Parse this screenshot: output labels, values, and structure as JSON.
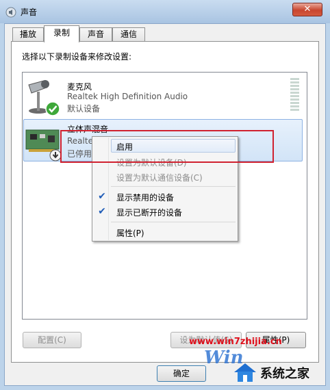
{
  "window": {
    "title": "声音",
    "close_label": "✕"
  },
  "tabs": [
    {
      "label": "播放"
    },
    {
      "label": "录制",
      "active": true
    },
    {
      "label": "声音"
    },
    {
      "label": "通信"
    }
  ],
  "instruction": "选择以下录制设备来修改设置:",
  "devices": [
    {
      "name": "麦克风",
      "driver": "Realtek High Definition Audio",
      "status": "默认设备",
      "icon": "microphone-icon",
      "badge": "default-check-badge"
    },
    {
      "name": "立体声混音",
      "driver": "Realte",
      "status": "已停用",
      "icon": "sound-card-icon",
      "badge": "disabled-arrow-badge"
    }
  ],
  "context_menu": {
    "items": [
      {
        "label": "启用",
        "enabled": true,
        "highlighted": true
      },
      {
        "label": "设置为默认设备(D)",
        "enabled": false
      },
      {
        "label": "设置为默认通信设备(C)",
        "enabled": false
      },
      {
        "label": "显示禁用的设备",
        "checked": true
      },
      {
        "label": "显示已断开的设备",
        "checked": true
      },
      {
        "label": "属性(P)",
        "enabled": true
      }
    ]
  },
  "buttons": {
    "configure": "配置(C)",
    "set_default": "设为默认值(S)",
    "properties": "属性(P)",
    "ok": "确定"
  },
  "watermark": {
    "url": "www.win7zhijia.cn",
    "brand": "系统之家",
    "win_text": "Win"
  },
  "colors": {
    "highlight_box": "#d0212f",
    "selection": "#d2e4f7",
    "check": "#1f5cb7"
  }
}
